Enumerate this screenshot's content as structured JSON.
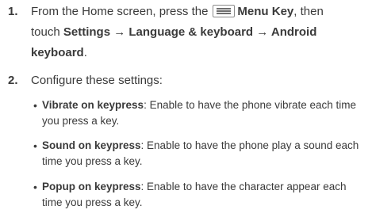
{
  "steps": [
    {
      "number": "1.",
      "line1_before": "From the Home screen, press the",
      "menu_key_icon": "menu-key-icon",
      "line1_bold": "Menu Key",
      "line1_after": ", then",
      "line2_before": "touch ",
      "line2_bold": "Settings → Language & keyboard → Android",
      "line3_bold": "keyboard",
      "line3_after": "."
    },
    {
      "number": "2.",
      "text": "Configure these settings:"
    }
  ],
  "settings": [
    {
      "name": "Vibrate on keypress",
      "line1": ": Enable to have the phone vibrate each time",
      "line2": "you press a key."
    },
    {
      "name": "Sound on keypress",
      "line1": ": Enable to have the phone play a sound each",
      "line2": "time you press a key."
    },
    {
      "name": "Popup on keypress",
      "line1": ": Enable to have the character appear each",
      "line2": "time you press a key."
    }
  ]
}
